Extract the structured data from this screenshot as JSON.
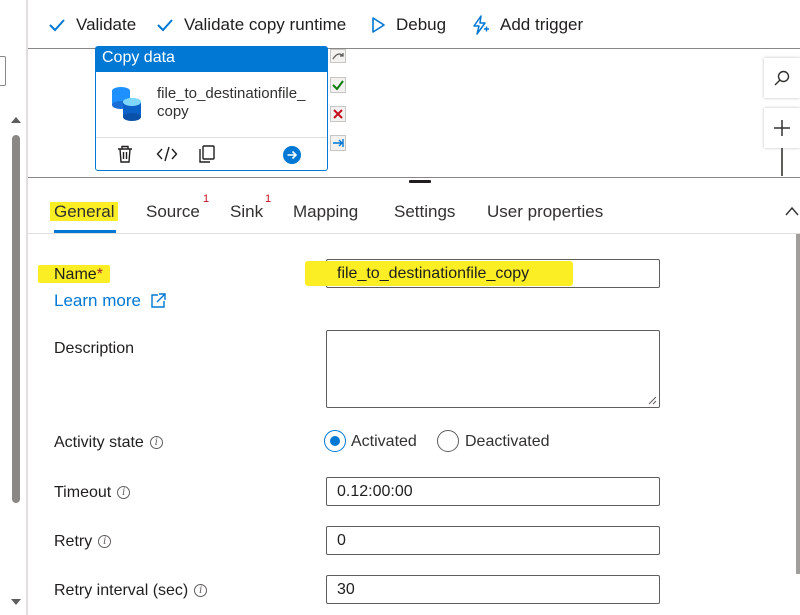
{
  "toolbar": {
    "validate": "Validate",
    "validate_copy_runtime": "Validate copy runtime",
    "debug": "Debug",
    "add_trigger": "Add trigger"
  },
  "activity": {
    "type_label": "Copy data",
    "name": "file_to_destinationfile_copy"
  },
  "tabs": [
    {
      "label": "General",
      "active": true,
      "badge": ""
    },
    {
      "label": "Source",
      "active": false,
      "badge": "1"
    },
    {
      "label": "Sink",
      "active": false,
      "badge": "1"
    },
    {
      "label": "Mapping",
      "active": false,
      "badge": ""
    },
    {
      "label": "Settings",
      "active": false,
      "badge": ""
    },
    {
      "label": "User properties",
      "active": false,
      "badge": ""
    }
  ],
  "form": {
    "name_label": "Name",
    "required_marker": "*",
    "name_value": "file_to_destinationfile_copy",
    "learn_more": "Learn more",
    "description_label": "Description",
    "description_value": "",
    "activity_state_label": "Activity state",
    "activated_label": "Activated",
    "deactivated_label": "Deactivated",
    "activity_state_selected": "Activated",
    "timeout_label": "Timeout",
    "timeout_value": "0.12:00:00",
    "retry_label": "Retry",
    "retry_value": "0",
    "retry_interval_label": "Retry interval (sec)",
    "retry_interval_value": "30"
  },
  "colors": {
    "accent": "#0078d4",
    "highlight": "#fbee24",
    "success": "#107c10",
    "error": "#c50f1f"
  }
}
